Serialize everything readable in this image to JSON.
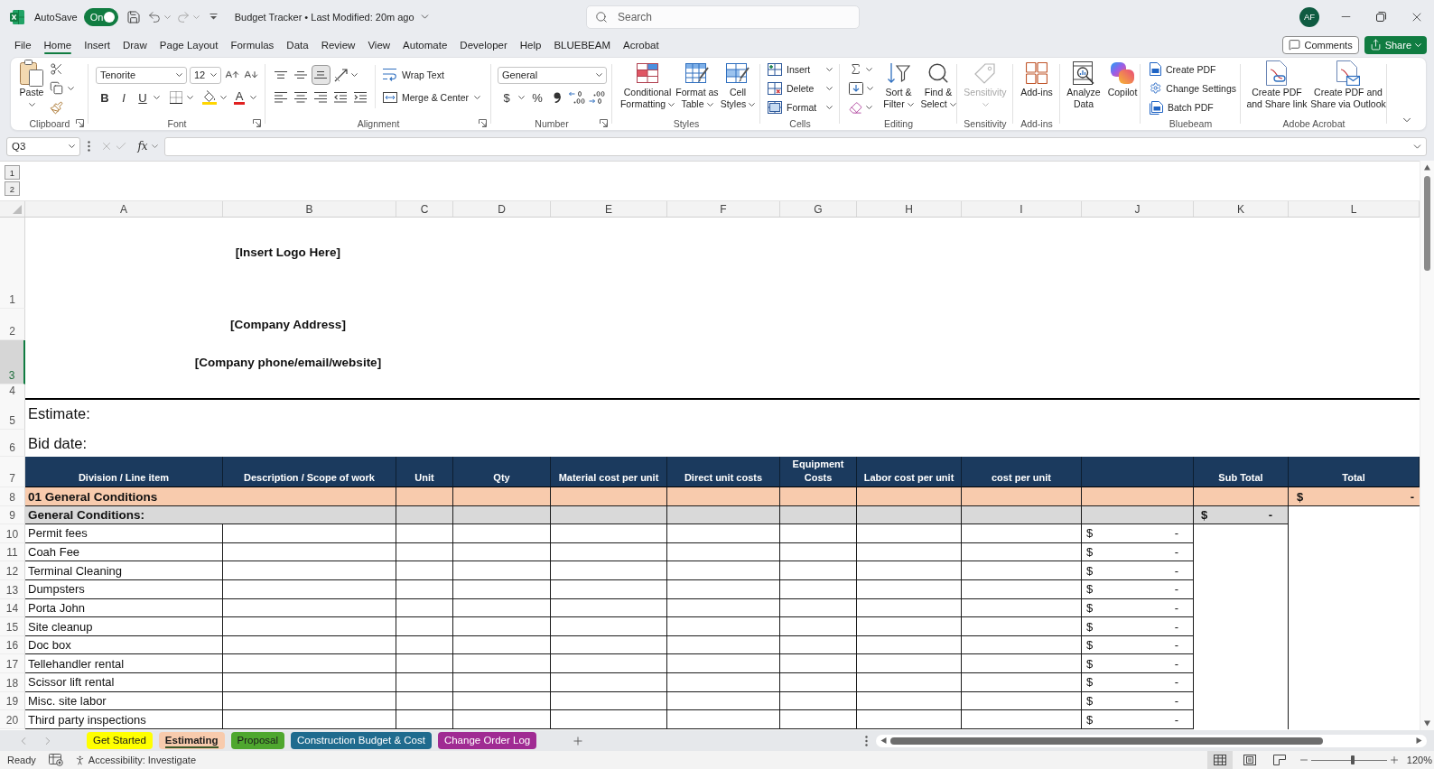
{
  "title_bar": {
    "autosave_label": "AutoSave",
    "autosave": {
      "text": "On",
      "on": true
    },
    "document": "Budget Tracker • Last Modified: 20m ago",
    "search": {
      "placeholder": "Search"
    },
    "account": "AF"
  },
  "menu": {
    "tabs": [
      {
        "label": "File",
        "selected": false
      },
      {
        "label": "Home",
        "selected": true
      },
      {
        "label": "Insert",
        "selected": false
      },
      {
        "label": "Draw",
        "selected": false
      },
      {
        "label": "Page Layout",
        "selected": false
      },
      {
        "label": "Formulas",
        "selected": false
      },
      {
        "label": "Data",
        "selected": false
      },
      {
        "label": "Review",
        "selected": false
      },
      {
        "label": "View",
        "selected": false
      },
      {
        "label": "Automate",
        "selected": false
      },
      {
        "label": "Developer",
        "selected": false
      },
      {
        "label": "Help",
        "selected": false
      },
      {
        "label": "BLUEBEAM",
        "selected": false
      },
      {
        "label": "Acrobat",
        "selected": false
      }
    ],
    "comments_button": "Comments",
    "share_button": "Share"
  },
  "ribbon": {
    "clipboard": {
      "label": "Clipboard",
      "paste": "Paste"
    },
    "font": {
      "label": "Font",
      "font_name": "Tenorite",
      "font_size": "12",
      "bold": "B",
      "italic": "I",
      "underline": "U",
      "font_color": "A"
    },
    "alignment": {
      "label": "Alignment",
      "vertical": [
        {
          "kind": "top",
          "selected": false
        },
        {
          "kind": "middle",
          "selected": false
        },
        {
          "kind": "bottom",
          "selected": true
        }
      ],
      "wrap_text": "Wrap Text",
      "merge": "Merge & Center"
    },
    "number": {
      "label": "Number",
      "format": "General",
      "currency": "$",
      "percent": "%"
    },
    "styles": {
      "label": "Styles",
      "buttons": [
        {
          "kind": "conditional",
          "lines": [
            "Conditional",
            "Formatting"
          ]
        },
        {
          "kind": "table",
          "lines": [
            "Format as",
            "Table"
          ]
        },
        {
          "kind": "cell_styles",
          "lines": [
            "Cell",
            "Styles"
          ]
        }
      ]
    },
    "cells": {
      "label": "Cells",
      "buttons": [
        {
          "kind": "insert",
          "text": "Insert"
        },
        {
          "kind": "delete",
          "text": "Delete"
        },
        {
          "kind": "format",
          "text": "Format"
        }
      ]
    },
    "editing": {
      "label": "Editing",
      "buttons": [
        {
          "kind": "sort",
          "lines": [
            "Sort &",
            "Filter"
          ]
        },
        {
          "kind": "find",
          "lines": [
            "Find &",
            "Select"
          ]
        }
      ]
    },
    "sensitivity": {
      "label": "Sensitivity",
      "button": "Sensitivity",
      "disabled": true
    },
    "add_ins": {
      "label": "Add-ins",
      "button": "Add-ins"
    },
    "assist": {
      "buttons": [
        {
          "kind": "analyze",
          "lines": [
            "Analyze",
            "Data"
          ]
        },
        {
          "kind": "copilot",
          "lines": [
            "Copilot"
          ]
        }
      ]
    },
    "bluebeam": {
      "label": "Bluebeam",
      "buttons": [
        {
          "kind": "create",
          "text": "Create PDF"
        },
        {
          "kind": "settings",
          "text": "Change Settings"
        },
        {
          "kind": "batch",
          "text": "Batch PDF"
        }
      ]
    },
    "acrobat": {
      "label": "Adobe Acrobat",
      "buttons": [
        {
          "kind": "share_link",
          "lines": [
            "Create PDF",
            "and Share link"
          ]
        },
        {
          "kind": "outlook",
          "lines": [
            "Create PDF and",
            "Share via Outlook"
          ]
        }
      ]
    }
  },
  "formula_bar": {
    "name_box": "Q3",
    "function_label": "fx"
  },
  "outline_levels": [
    "1",
    "2"
  ],
  "sheet": {
    "columns": [
      "A",
      "B",
      "C",
      "D",
      "E",
      "F",
      "G",
      "H",
      "I",
      "J",
      "K",
      "L"
    ],
    "rows": [
      {
        "number": "1",
        "selected": false,
        "kind": "banner",
        "text": "[Insert Logo Here]"
      },
      {
        "number": "2",
        "selected": false,
        "kind": "banner",
        "text": "[Company Address]"
      },
      {
        "number": "3",
        "selected": true,
        "kind": "banner",
        "text": "[Company phone/email/website]"
      },
      {
        "number": "4",
        "selected": false,
        "kind": "rule"
      },
      {
        "number": "5",
        "selected": false,
        "kind": "field_label",
        "text": "Estimate:"
      },
      {
        "number": "6",
        "selected": false,
        "kind": "field_label",
        "text": "Bid date:"
      },
      {
        "number": "7",
        "selected": false,
        "kind": "header",
        "cells": [
          {
            "kind": "text",
            "text": "Division / Line item"
          },
          {
            "kind": "text",
            "text": "Description / Scope of work"
          },
          {
            "kind": "text",
            "text": "Unit"
          },
          {
            "kind": "text",
            "text": "Qty"
          },
          {
            "kind": "text",
            "text": "Material cost per unit"
          },
          {
            "kind": "text",
            "text": "Direct unit costs"
          },
          {
            "kind": "text",
            "text": "Equipment Costs"
          },
          {
            "kind": "text",
            "text": "Labor cost per unit"
          },
          {
            "kind": "text",
            "text": "cost per unit"
          },
          {
            "kind": "blank"
          },
          {
            "kind": "text",
            "text": "Sub Total"
          },
          {
            "kind": "text",
            "text": "Total"
          }
        ]
      },
      {
        "number": "8",
        "selected": false,
        "kind": "division",
        "text": "01 General Conditions",
        "total": {
          "currency": "$",
          "amount": "-"
        }
      },
      {
        "number": "9",
        "selected": false,
        "kind": "section",
        "text": "General Conditions:",
        "subtotal": {
          "currency": "$",
          "amount": "-"
        }
      },
      {
        "number": "10",
        "selected": false,
        "kind": "item",
        "text": "Permit fees",
        "cost": {
          "currency": "$",
          "amount": "-"
        }
      },
      {
        "number": "11",
        "selected": false,
        "kind": "item",
        "text": "Coah Fee",
        "cost": {
          "currency": "$",
          "amount": "-"
        }
      },
      {
        "number": "12",
        "selected": false,
        "kind": "item",
        "text": "Terminal Cleaning",
        "cost": {
          "currency": "$",
          "amount": "-"
        }
      },
      {
        "number": "13",
        "selected": false,
        "kind": "item",
        "text": "Dumpsters",
        "cost": {
          "currency": "$",
          "amount": "-"
        }
      },
      {
        "number": "14",
        "selected": false,
        "kind": "item",
        "text": "Porta John",
        "cost": {
          "currency": "$",
          "amount": "-"
        }
      },
      {
        "number": "15",
        "selected": false,
        "kind": "item",
        "text": "Site cleanup",
        "cost": {
          "currency": "$",
          "amount": "-"
        }
      },
      {
        "number": "16",
        "selected": false,
        "kind": "item",
        "text": "Doc box",
        "cost": {
          "currency": "$",
          "amount": "-"
        }
      },
      {
        "number": "17",
        "selected": false,
        "kind": "item",
        "text": "Tellehandler rental",
        "cost": {
          "currency": "$",
          "amount": "-"
        }
      },
      {
        "number": "18",
        "selected": false,
        "kind": "item",
        "text": "Scissor lift rental",
        "cost": {
          "currency": "$",
          "amount": "-"
        }
      },
      {
        "number": "19",
        "selected": false,
        "kind": "item",
        "text": "Misc. site labor",
        "cost": {
          "currency": "$",
          "amount": "-"
        }
      },
      {
        "number": "20",
        "selected": false,
        "kind": "item",
        "text": "Third party inspections",
        "cost": {
          "currency": "$",
          "amount": "-"
        }
      }
    ]
  },
  "sheet_tabs": [
    {
      "label": "Get Started",
      "selected": false,
      "color": "#ffff00"
    },
    {
      "label": "Estimating",
      "selected": true,
      "color": "#f8cbad"
    },
    {
      "label": "Proposal",
      "selected": false,
      "color": "#4ea72e"
    },
    {
      "label": "Construction Budget & Cost",
      "selected": false,
      "color": "#1f6b8e"
    },
    {
      "label": "Change Order Log",
      "selected": false,
      "color": "#a02b93"
    }
  ],
  "status_bar": {
    "status": "Ready",
    "accessibility": "Accessibility: Investigate",
    "views": [
      {
        "kind": "normal",
        "selected": true
      },
      {
        "kind": "page_layout",
        "selected": false
      },
      {
        "kind": "page_break",
        "selected": false
      }
    ],
    "zoom": {
      "level": 0.55,
      "reading": "120%"
    }
  }
}
